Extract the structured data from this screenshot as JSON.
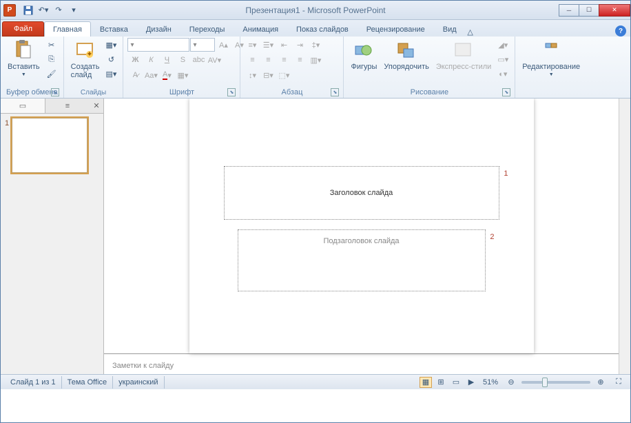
{
  "title": "Презентация1 - Microsoft PowerPoint",
  "qat": {
    "save": "💾",
    "undo": "↶",
    "redo": "↷"
  },
  "tabs": {
    "file": "Файл",
    "items": [
      "Главная",
      "Вставка",
      "Дизайн",
      "Переходы",
      "Анимация",
      "Показ слайдов",
      "Рецензирование",
      "Вид"
    ],
    "active": 0
  },
  "ribbon": {
    "clipboard": {
      "label": "Буфер обмена",
      "paste": "Вставить"
    },
    "slides": {
      "label": "Слайды",
      "new": "Создать\nслайд"
    },
    "font": {
      "label": "Шрифт"
    },
    "paragraph": {
      "label": "Абзац"
    },
    "drawing": {
      "label": "Рисование",
      "shapes": "Фигуры",
      "arrange": "Упорядочить",
      "styles": "Экспресс-стили"
    },
    "editing": {
      "label": "",
      "find": "Редактирование"
    }
  },
  "thumb": {
    "num": "1"
  },
  "slide": {
    "title_placeholder": "Заголовок слайда",
    "subtitle_placeholder": "Подзаголовок слайда",
    "n1": "1",
    "n2": "2"
  },
  "notes": "Заметки к слайду",
  "status": {
    "slide": "Слайд 1 из 1",
    "theme": "Тема Office",
    "lang": "украинский",
    "zoom": "51%"
  }
}
